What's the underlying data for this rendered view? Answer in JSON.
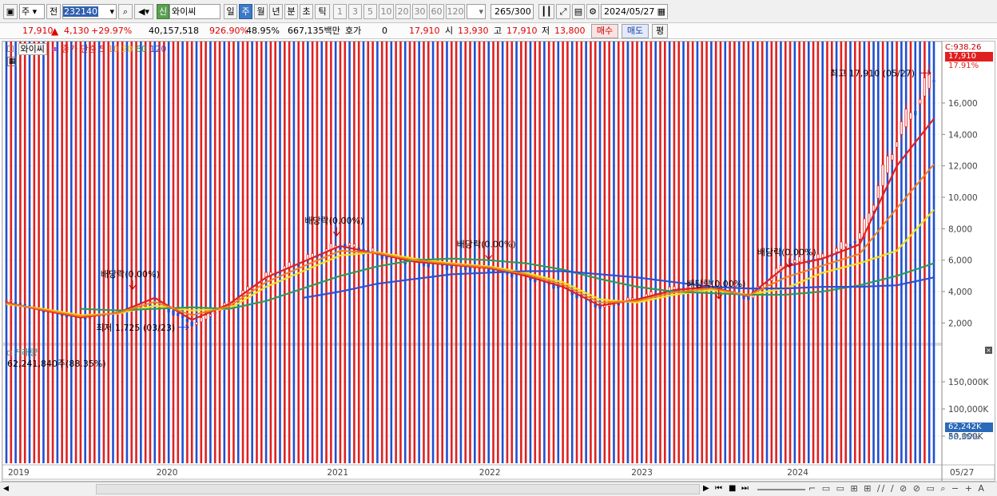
{
  "toolbar": {
    "type_label": "주",
    "prev_label": "전",
    "stock_code": "232140",
    "badge": "신",
    "stock_name": "와이씨",
    "periods": [
      "일",
      "주",
      "월",
      "년",
      "분",
      "초",
      "틱"
    ],
    "selected_period": "주",
    "intervals": [
      "1",
      "3",
      "5",
      "10",
      "20",
      "30",
      "60",
      "120"
    ],
    "count_value": "265",
    "count_total": "/300",
    "date_value": "2024/05/27"
  },
  "pricebar": {
    "price": "17,910",
    "change": "4,130",
    "change_pct": "+29.97%",
    "volume": "40,157,518",
    "volume_pct": "926.90%",
    "turnover": "48.95%",
    "amount": "667,135백만",
    "hoga_label": "호가",
    "hoga_value": "0",
    "current": "17,910",
    "open_label": "시",
    "open": "13,930",
    "high_label": "고",
    "high": "17,910",
    "low_label": "저",
    "low": "13,800",
    "buy_label": "매수",
    "sell_label": "매도",
    "eval_label": "평"
  },
  "legend": {
    "name": "와이씨",
    "ma_label": "종가 단순",
    "ma_periods": [
      "5",
      "10",
      "20",
      "60",
      "120"
    ],
    "colors": {
      "ma5": "#e02020",
      "ma10": "#f08020",
      "ma20": "#f0e020",
      "ma60": "#2e9a5a",
      "ma120": "#3050d0"
    }
  },
  "price_axis": {
    "ticks": [
      "16,000",
      "14,000",
      "12,000",
      "10,000",
      "8,000",
      "6,000",
      "4,000",
      "2,000"
    ],
    "top_label": "C:938.26",
    "last_price": "17,910",
    "last_pct": "17.91%"
  },
  "volume_panel": {
    "title": "거래량",
    "value": "62,241,840주(88.35%)",
    "ticks": [
      "150,000K",
      "100,000K",
      "50,000K"
    ],
    "last_volume": "62,242K",
    "last_pct": "88.35%"
  },
  "time_axis": {
    "labels": [
      "2019",
      "2020",
      "2021",
      "2022",
      "2023",
      "2024"
    ],
    "end_label": "05/27"
  },
  "annotations": {
    "dividend_label": "배당락(0.00%)",
    "high_marker": "최고 17,910 (05/27)",
    "low_marker": "최저 1,725 (03/23)"
  },
  "chart_data": {
    "type": "line",
    "title": "",
    "xlabel": "",
    "ylabel": "",
    "ylim": [
      800,
      19200
    ],
    "x": [
      "2019-01",
      "2019-04",
      "2019-07",
      "2019-10",
      "2020-01",
      "2020-03",
      "2020-06",
      "2020-09",
      "2020-12",
      "2021-03",
      "2021-06",
      "2021-09",
      "2021-12",
      "2022-03",
      "2022-06",
      "2022-09",
      "2022-12",
      "2023-03",
      "2023-06",
      "2023-09",
      "2023-12",
      "2024-01",
      "2024-02",
      "2024-03",
      "2024-04",
      "2024-05"
    ],
    "series": [
      {
        "name": "종가",
        "values": [
          3400,
          2800,
          2300,
          2700,
          3300,
          1900,
          3300,
          5000,
          6000,
          7000,
          6400,
          5900,
          5600,
          5400,
          5000,
          4200,
          3000,
          3600,
          4200,
          4300,
          3600,
          5800,
          6200,
          7500,
          14000,
          17910
        ]
      },
      {
        "name": "5",
        "values": [
          3300,
          2800,
          2350,
          2650,
          3600,
          2200,
          3200,
          4900,
          5900,
          6900,
          6400,
          5900,
          5700,
          5500,
          5000,
          4300,
          3100,
          3500,
          4100,
          4300,
          3700,
          5600,
          6100,
          7000,
          12000,
          15000
        ]
      },
      {
        "name": "20",
        "values": [
          3200,
          2900,
          2500,
          2600,
          3100,
          2800,
          2900,
          4300,
          5300,
          6300,
          6500,
          6100,
          5800,
          5600,
          5200,
          4600,
          3500,
          3300,
          3800,
          4100,
          3800,
          4200,
          5200,
          5800,
          6600,
          9200
        ]
      },
      {
        "name": "60",
        "values": [
          null,
          null,
          2900,
          2800,
          2900,
          3000,
          2900,
          3400,
          4200,
          5000,
          5600,
          6000,
          6100,
          6000,
          5800,
          5400,
          4800,
          4300,
          4000,
          3900,
          3800,
          3800,
          4000,
          4400,
          5000,
          5800
        ]
      },
      {
        "name": "120",
        "values": [
          null,
          null,
          null,
          null,
          null,
          null,
          null,
          null,
          3600,
          4000,
          4500,
          4800,
          5100,
          5200,
          5300,
          5300,
          5100,
          4900,
          4600,
          4300,
          4200,
          4200,
          4300,
          4300,
          4400,
          4900
        ]
      }
    ],
    "volume_k": [
      2000,
      1800,
      2500,
      9000,
      6000,
      14000,
      8000,
      45000,
      20000,
      6000,
      5000,
      5000,
      9000,
      5000,
      3000,
      8000,
      4000,
      5000,
      6000,
      6000,
      4000,
      78000,
      30000,
      55000,
      185000,
      62242
    ]
  }
}
